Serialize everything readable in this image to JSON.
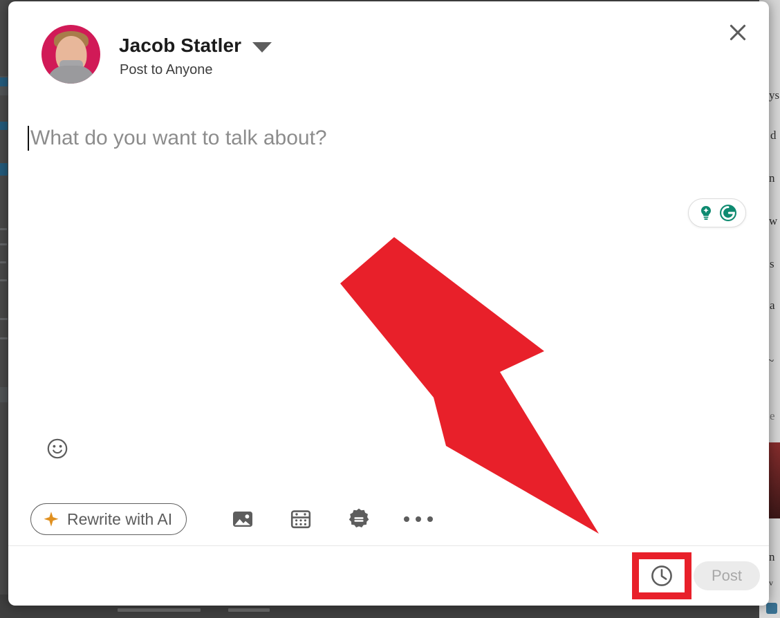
{
  "modal": {
    "name": "post-composer",
    "header": {
      "author_name": "Jacob Statler",
      "audience": "Post to Anyone",
      "dropdown_icon": "chevron-down-icon",
      "close_icon": "close-icon",
      "avatar_alt": "Jacob Statler profile photo",
      "avatar_bg_color": "#d11a57"
    },
    "editor": {
      "placeholder": "What do you want to talk about?",
      "value": "",
      "caret_visible": true,
      "grammarly": {
        "assistant_icon": "grammarly-lightbulb-icon",
        "logo_icon": "grammarly-logo-icon",
        "accent_color": "#11866f"
      },
      "emoji_icon": "emoji-smiley-icon"
    },
    "toolbar": {
      "rewrite_label": "Rewrite with AI",
      "rewrite_icon": "sparkle-icon",
      "rewrite_icon_color": "#e09020",
      "image_icon": "image-icon",
      "event_icon": "calendar-icon",
      "job_icon": "job-badge-icon",
      "more_icon": "more-options-icon"
    },
    "footer": {
      "schedule_icon": "clock-icon",
      "schedule_highlighted": true,
      "highlight_color": "#e8202a",
      "post_label": "Post",
      "post_disabled": true
    }
  },
  "annotation": {
    "arrow": {
      "type": "arrow-pointer",
      "color": "#e8202a",
      "points_to": "schedule-post-button",
      "direction": "down-right"
    }
  }
}
